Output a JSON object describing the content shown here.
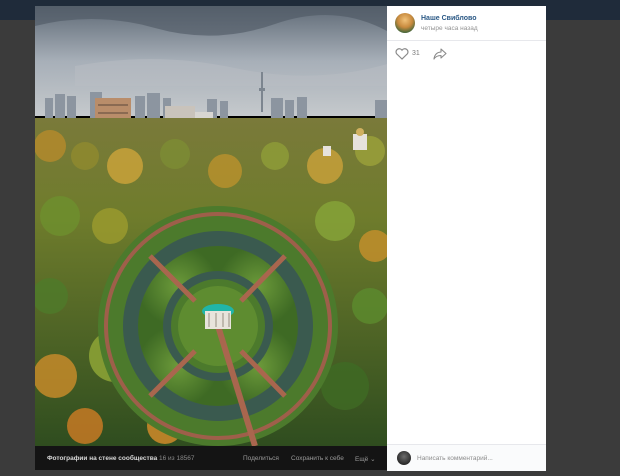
{
  "post": {
    "author_name": "Наше Свиблово",
    "time": "четыре часа назад",
    "likes": "31"
  },
  "photo_footer": {
    "album_label": "Фотографии на стене сообщества",
    "counter": "16 из 18567",
    "share_label": "Поделиться",
    "save_label": "Сохранить к себе",
    "more_label": "Ещё ⌄"
  },
  "comment": {
    "placeholder": "Написать комментарий..."
  },
  "icons": {
    "like": "heart-icon",
    "share": "share-arrow-icon"
  }
}
